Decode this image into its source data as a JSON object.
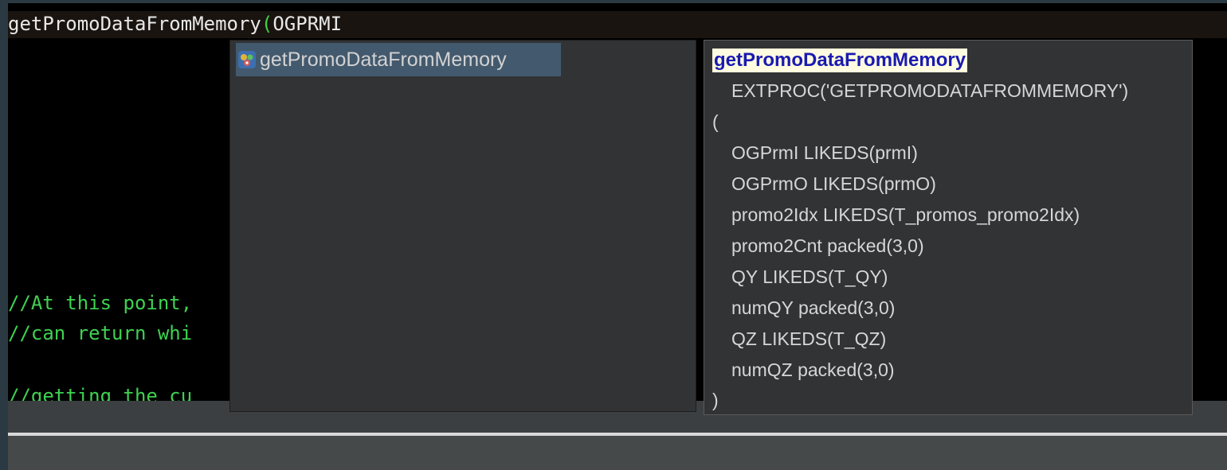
{
  "editor": {
    "current_line": {
      "name": "getPromoDataFromMemory",
      "paren": "(",
      "arg": "OGPRMI"
    },
    "comments": [
      "//At this point,",
      "//can return whi",
      "//getting the cu"
    ]
  },
  "content_assist": {
    "proposals": [
      {
        "label": "getPromoDataFromMemory",
        "icon": "procedure-icon"
      }
    ]
  },
  "detail": {
    "title": "getPromoDataFromMemory",
    "lines": [
      "EXTPROC('GETPROMODATAFROMMEMORY')",
      "(",
      "OGPrmI LIKEDS(prmI)",
      "OGPrmO LIKEDS(prmO)",
      "promo2Idx LIKEDS(T_promos_promo2Idx)",
      "promo2Cnt packed(3,0)",
      "QY LIKEDS(T_QY)",
      "numQY packed(3,0)",
      "QZ LIKEDS(T_QZ)",
      "numQZ packed(3,0)",
      ")"
    ]
  },
  "colors": {
    "comment": "#3ed251",
    "selection": "#43596d",
    "title_highlight": "#fffbe0"
  }
}
